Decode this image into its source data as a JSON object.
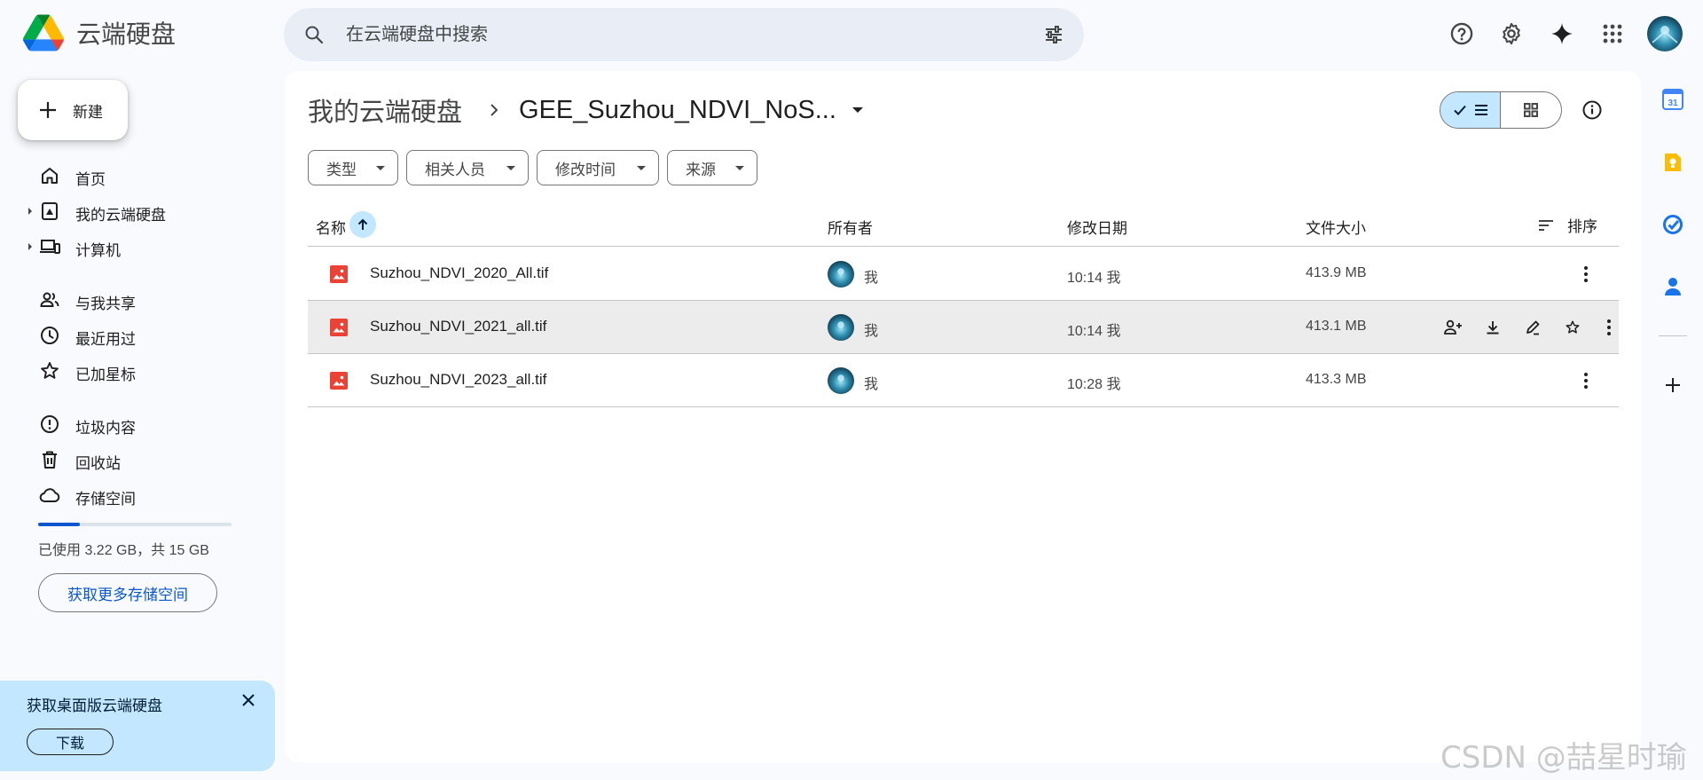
{
  "app": {
    "title": "云端硬盘"
  },
  "search": {
    "placeholder": "在云端硬盘中搜索"
  },
  "header_icons": [
    "help-icon",
    "settings-icon",
    "gemini-icon",
    "apps-grid-icon",
    "account-avatar"
  ],
  "sidebar": {
    "new_label": "新建",
    "items": [
      {
        "label": "首页",
        "icon": "home-icon"
      },
      {
        "label": "我的云端硬盘",
        "icon": "my-drive-icon",
        "expandable": true
      },
      {
        "label": "计算机",
        "icon": "computers-icon",
        "expandable": true
      },
      {
        "label": "与我共享",
        "icon": "shared-icon"
      },
      {
        "label": "最近用过",
        "icon": "clock-icon"
      },
      {
        "label": "已加星标",
        "icon": "star-icon"
      },
      {
        "label": "垃圾内容",
        "icon": "spam-icon"
      },
      {
        "label": "回收站",
        "icon": "trash-icon"
      },
      {
        "label": "存储空间",
        "icon": "cloud-icon"
      }
    ],
    "storage": {
      "used_fraction": 0.215,
      "text": "已使用 3.22 GB，共 15 GB",
      "button": "获取更多存储空间"
    },
    "promo": {
      "title": "获取桌面版云端硬盘",
      "button": "下载"
    }
  },
  "breadcrumb": {
    "root": "我的云端硬盘",
    "current": "GEE_Suzhou_NDVI_NoS..."
  },
  "filters": [
    "类型",
    "相关人员",
    "修改时间",
    "来源"
  ],
  "table": {
    "headers": {
      "name": "名称",
      "owner": "所有者",
      "modified": "修改日期",
      "size": "文件大小",
      "sort": "排序"
    },
    "rows": [
      {
        "name": "Suzhou_NDVI_2020_All.tif",
        "owner": "我",
        "modified": "10:14 我",
        "size": "413.9 MB"
      },
      {
        "name": "Suzhou_NDVI_2021_all.tif",
        "owner": "我",
        "modified": "10:14 我",
        "size": "413.1 MB"
      },
      {
        "name": "Suzhou_NDVI_2023_all.tif",
        "owner": "我",
        "modified": "10:28 我",
        "size": "413.3 MB"
      }
    ]
  },
  "right_rail": [
    "calendar-icon",
    "keep-icon",
    "tasks-icon",
    "contacts-icon",
    "add-icon"
  ],
  "calendar_day": "31",
  "watermark": "CSDN @喆星时瑜",
  "colors": {
    "accent": "#0b57d0",
    "selected": "#c2e7ff",
    "hover_row": "#ececec",
    "image_file": "#ea4335"
  }
}
